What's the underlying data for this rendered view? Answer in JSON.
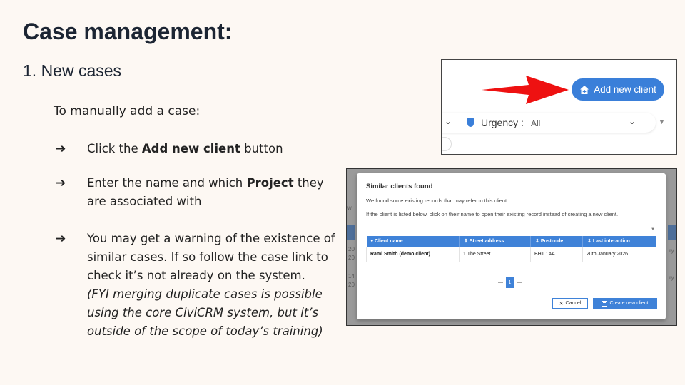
{
  "slide": {
    "title": "Case management:",
    "subtitle": "1. New cases",
    "intro": "To manually add a case:",
    "arrow": "➔",
    "steps": {
      "s1": {
        "pre": "Click the ",
        "bold": "Add new client",
        "post": " button"
      },
      "s2": {
        "pre": "Enter the name and which ",
        "bold": "Project",
        "post": " they are associated with"
      },
      "s3": {
        "text": "You may get a warning of the existence of similar cases. If so follow the case link to check it’s not already on the system.",
        "note": "(FYI merging duplicate cases is possible using the core CiviCRM system, but it’s outside of the scope of today’s training)"
      }
    }
  },
  "screenshot1": {
    "add_client_label": "Add new client",
    "urgency_label": "Urgency :",
    "urgency_value": "All",
    "colors": {
      "button": "#3a7fd9",
      "arrow": "#ee1111"
    }
  },
  "screenshot2": {
    "title": "Similar clients found",
    "line1": "We found some existing records that may refer to this client.",
    "line2": "If the client is listed below, click on their name to open their existing record instead of creating a new client.",
    "columns": [
      "Client name",
      "Street address",
      "Postcode",
      "Last interaction"
    ],
    "row": [
      "Rami Smith (demo client)",
      "1 The Street",
      "BH1 1AA",
      "20th January 2026"
    ],
    "page": "1",
    "cancel_label": "Cancel",
    "create_label": "Create new client",
    "bg_fragments": [
      "w",
      "20",
      "20",
      "14",
      "20",
      "ry",
      "ry"
    ]
  }
}
